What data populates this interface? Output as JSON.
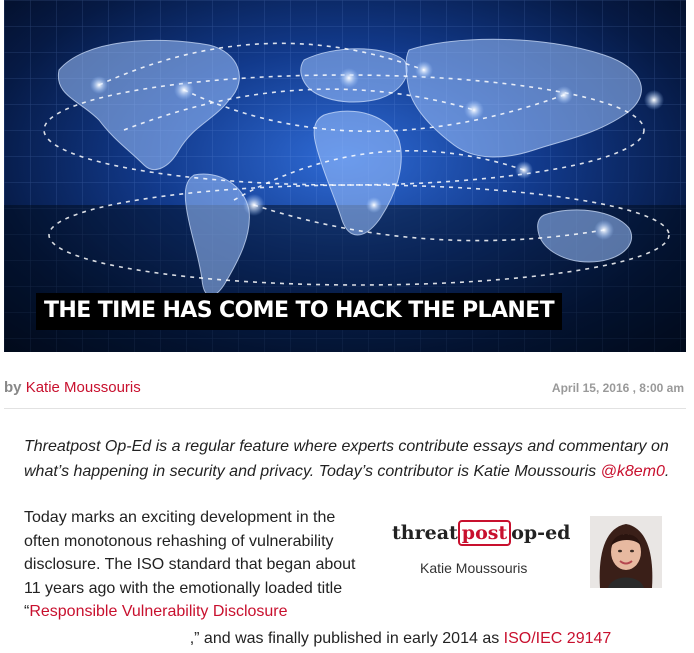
{
  "hero": {
    "title": "THE TIME HAS COME TO HACK THE PLANET"
  },
  "byline": {
    "by": "by",
    "author": "Katie Moussouris",
    "date": "April 15, 2016 , 8:00 am"
  },
  "intro": {
    "text_before": "Threatpost Op-Ed is a regular feature where experts contribute essays and commentary on what’s happening in security and privacy. Today’s contributor is Katie Moussouris ",
    "handle": "@k8em0",
    "text_after": "."
  },
  "article": {
    "p1_text": "Today marks an exciting development in the often monotonous rehashing of vulnerability disclosure. The ISO standard that began about 11 years ago with the emotionally loaded title “",
    "p1_link": "Responsible Vulnerability Disclosure",
    "p1_after": ",” and was finally published in early 2014 as ",
    "p1_link2": "ISO/IEC 29147"
  },
  "logo_card": {
    "threat": "threat",
    "post": "post",
    "oped": "op-ed",
    "name": "Katie Moussouris"
  },
  "colors": {
    "accent": "#c8102e",
    "hero_bg": "#123a8c"
  }
}
